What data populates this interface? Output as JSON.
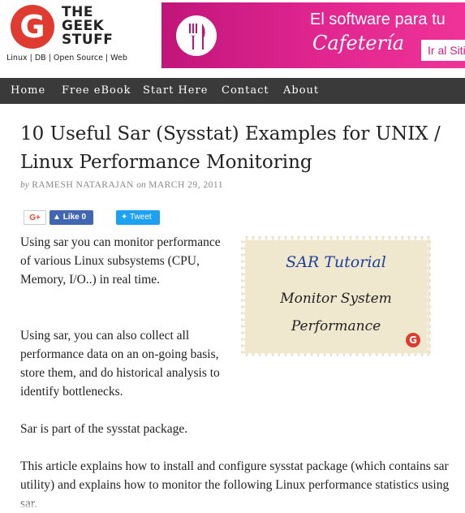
{
  "header": {
    "logo": {
      "letter": "G",
      "line1": "THE",
      "line2": "GEEK",
      "line3": "STUFF",
      "tagline": "Linux | DB | Open Source | Web",
      "brand_color": "#e03b30"
    },
    "ad": {
      "line1": "El software para tu",
      "line2": "Cafetería",
      "button": "Ir al Siti",
      "icon": "fork-knife-icon",
      "color": "#e0258f"
    }
  },
  "nav": {
    "items": [
      "Home",
      "Free eBook",
      "Start Here",
      "Contact",
      "About"
    ],
    "background": "#3a3a3a"
  },
  "article": {
    "title": "10 Useful Sar (Sysstat) Examples for UNIX / Linux Performance Monitoring",
    "byline": {
      "by": "by",
      "author": "RAMESH NATARAJAN",
      "on": "on",
      "date": "MARCH 29, 2011"
    },
    "share": {
      "gplus": "G+",
      "facebook": "Like 0",
      "twitter": "Tweet"
    },
    "image": {
      "title": "SAR Tutorial",
      "line1": "Monitor System",
      "line2": "Performance",
      "badge": "G"
    },
    "paragraphs": [
      "Using sar you can monitor performance of various Linux subsystems (CPU, Memory, I/O..) in real time.",
      "Using sar, you can also collect all performance data on an on-going basis, store them, and do historical analysis to identify bottlenecks.",
      "Sar is part of the sysstat package.",
      "This article explains how to install and configure sysstat package (which contains sar utility) and explains how to monitor the following Linux performance statistics using sar."
    ]
  }
}
